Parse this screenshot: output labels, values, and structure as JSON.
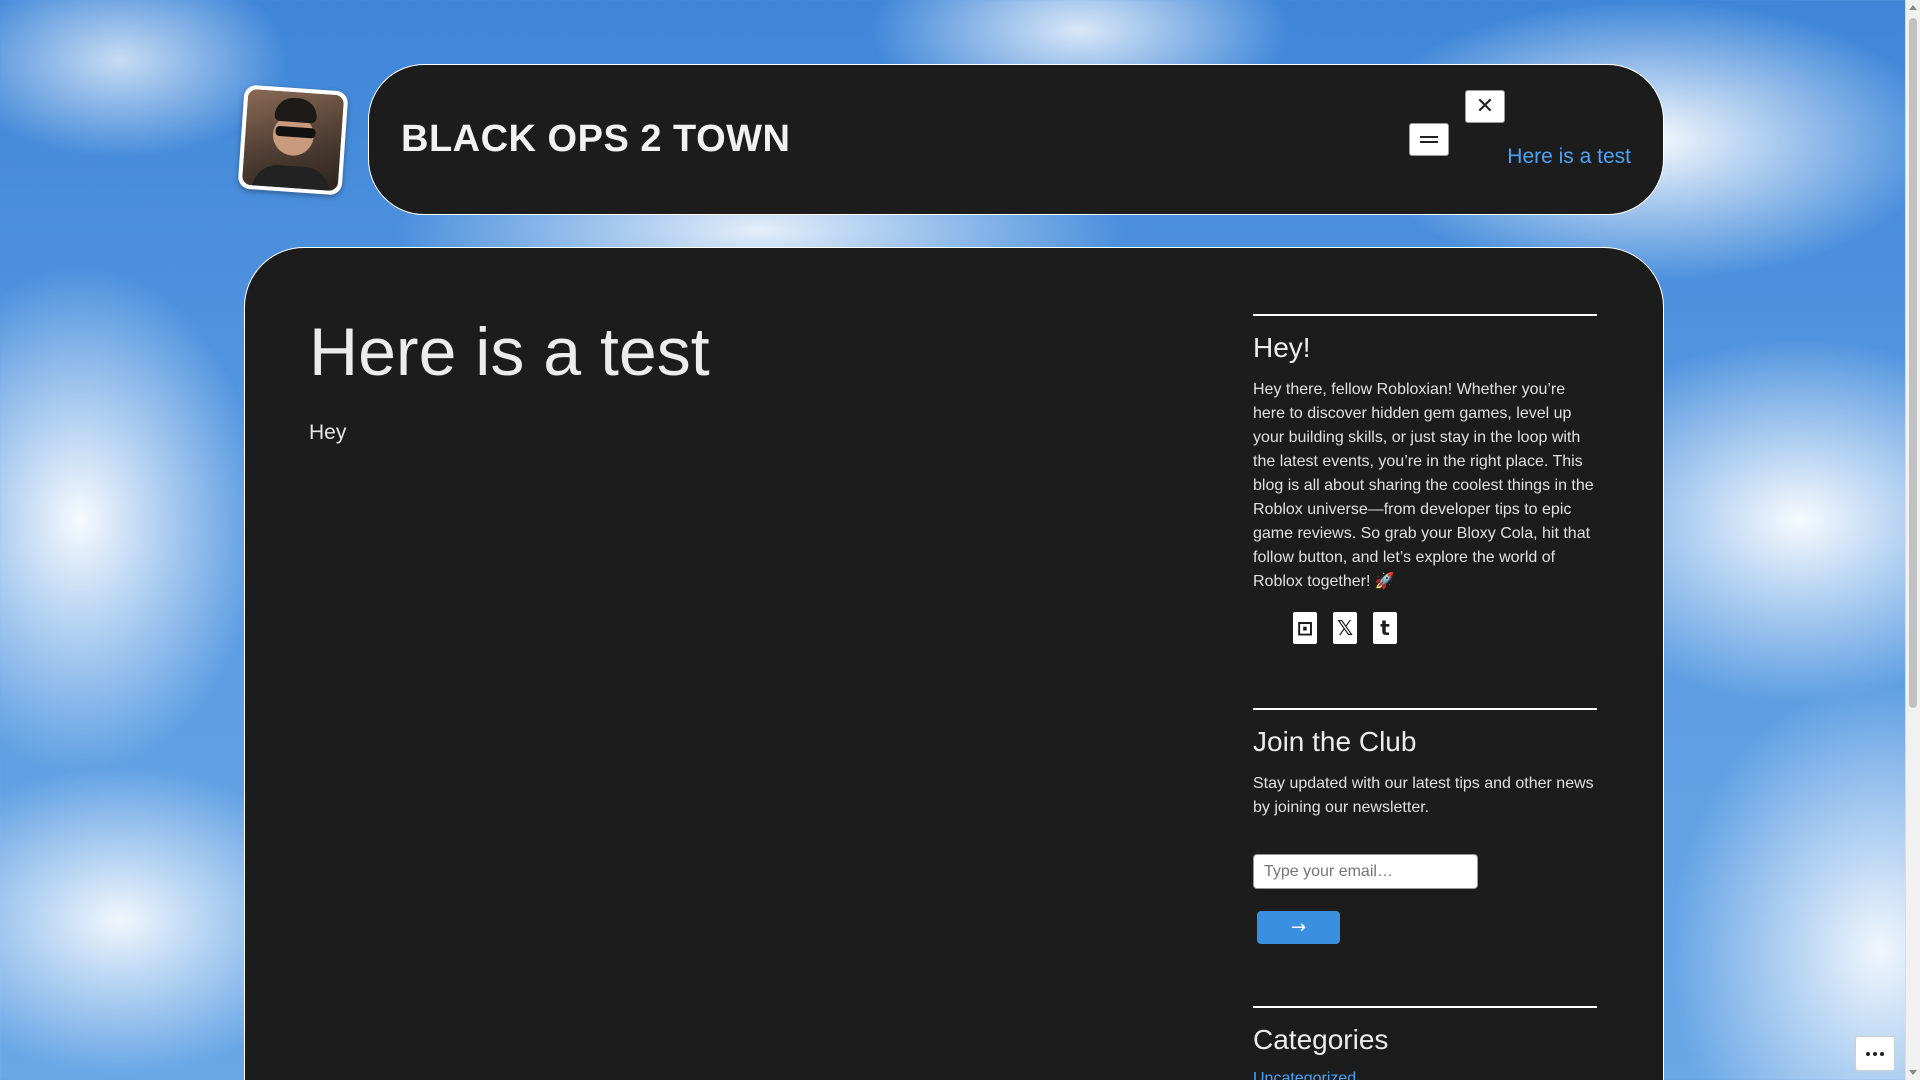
{
  "header": {
    "site_title": "BLACK OPS 2 TOWN",
    "nav_link": "Here is a test",
    "close_symbol": "✕"
  },
  "post": {
    "title": "Here is a test",
    "body": "Hey"
  },
  "sidebar": {
    "about": {
      "heading": "Hey!",
      "text": "Hey there, fellow Robloxian! Whether you’re here to discover hidden gem games, level up your building skills, or just stay in the loop with the latest events, you’re in the right place. This blog is all about sharing the coolest things in the Roblox universe—from developer tips to epic game reviews. So grab your Bloxy Cola, hit that follow button, and let’s explore the world of Roblox together! 🚀",
      "social_icons": [
        "twitch-icon",
        "x-icon",
        "tumblr-icon"
      ],
      "social_glyphs": [
        "⊡",
        "𝕏",
        "t"
      ]
    },
    "newsletter": {
      "heading": "Join the Club",
      "text": "Stay updated with our latest tips and other news by joining our newsletter.",
      "email_placeholder": "Type your email…",
      "submit_label": "→"
    },
    "categories": {
      "heading": "Categories",
      "items": [
        "Uncategorized"
      ]
    }
  },
  "colors": {
    "panel": "#1c1c1c",
    "link": "#4aa3f5",
    "button": "#3b8fe0"
  }
}
